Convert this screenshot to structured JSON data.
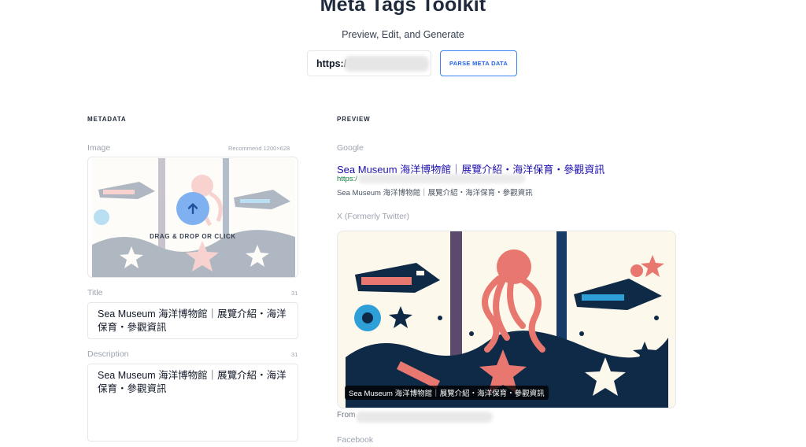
{
  "header": {
    "title": "Meta Tags Toolkit",
    "subtitle": "Preview, Edit, and Generate",
    "url_value": "https:/",
    "parse_button": "PARSE META DATA"
  },
  "metadata": {
    "heading": "METADATA",
    "image": {
      "label": "Image",
      "hint": "Recommend 1200×628",
      "drop_text": "DRAG & DROP OR CLICK",
      "icon": "arrow-up-icon"
    },
    "title": {
      "label": "Title",
      "count": "31",
      "value": "Sea Museum 海洋博物館｜展覽介紹・海洋保育・參觀資訊"
    },
    "description": {
      "label": "Description",
      "count": "31",
      "value": "Sea Museum 海洋博物館｜展覽介紹・海洋保育・參觀資訊"
    }
  },
  "preview": {
    "heading": "PREVIEW",
    "google": {
      "label": "Google",
      "title": "Sea Museum 海洋博物館｜展覽介紹・海洋保育・參觀資訊",
      "url": "https:/",
      "description": "Sea Museum 海洋博物館｜展覽介紹・海洋保育・參觀資訊"
    },
    "x": {
      "label": "X (Formerly Twitter)",
      "caption": "Sea Museum 海洋博物館｜展覽介紹・海洋保育・參觀資訊",
      "from": "From"
    },
    "facebook": {
      "label": "Facebook"
    }
  },
  "colors": {
    "accent": "#3b82f6",
    "link": "#1a0dab",
    "url_green": "#15803d",
    "art_navy": "#0f2a47",
    "art_coral": "#e8776f",
    "art_blue": "#2f9fd8"
  }
}
